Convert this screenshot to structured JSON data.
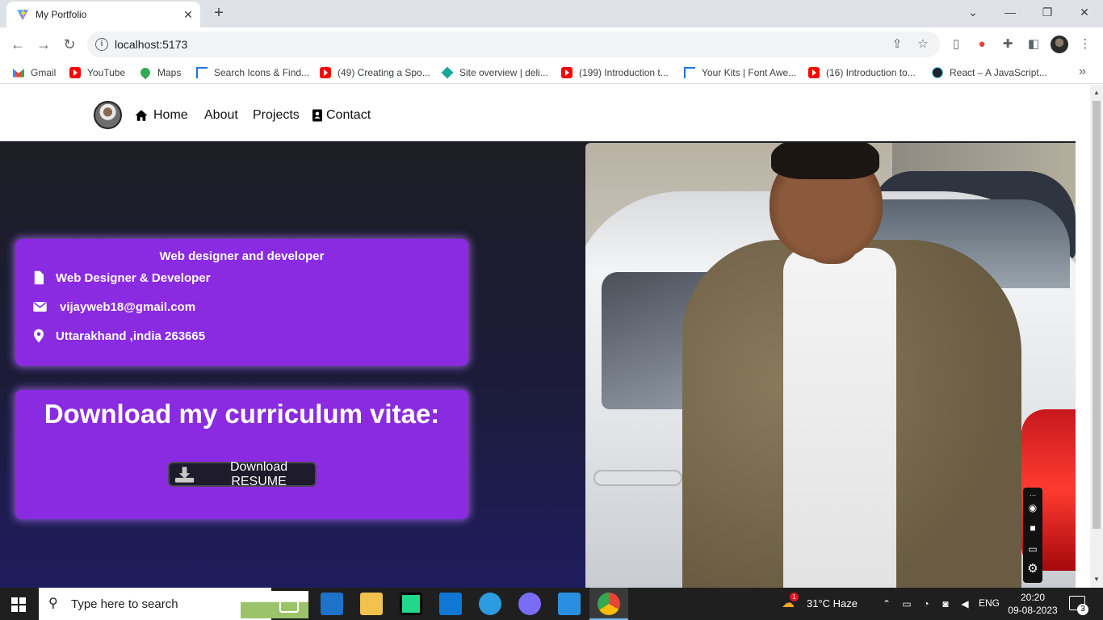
{
  "browser": {
    "tab": {
      "title": "My Portfolio"
    },
    "url": "localhost:5173",
    "bookmarks": [
      {
        "label": "Gmail",
        "icon": "gmail-icon"
      },
      {
        "label": "YouTube",
        "icon": "youtube-icon"
      },
      {
        "label": "Maps",
        "icon": "maps-icon"
      },
      {
        "label": "Search Icons & Find...",
        "icon": "flag-icon"
      },
      {
        "label": "(49) Creating a Spo...",
        "icon": "youtube-icon"
      },
      {
        "label": "Site overview | deli...",
        "icon": "diamond-icon"
      },
      {
        "label": "(199) Introduction t...",
        "icon": "youtube-icon"
      },
      {
        "label": "Your Kits | Font Awe...",
        "icon": "flag-icon"
      },
      {
        "label": "(16) Introduction to...",
        "icon": "youtube-icon"
      },
      {
        "label": "React – A JavaScript...",
        "icon": "react-icon"
      }
    ]
  },
  "site": {
    "nav": {
      "home": "Home",
      "about": "About",
      "projects": "Projects",
      "contact": "Contact"
    },
    "info_card": {
      "title": "Web designer and developer",
      "role": "Web Designer & Developer",
      "email": "vijayweb18@gmail.com",
      "location": "Uttarakhand ,india 263665"
    },
    "cv_card": {
      "title": "Download my curriculum vitae:",
      "button": "Download RESUME"
    }
  },
  "taskbar": {
    "search_placeholder": "Type here to search",
    "weather": "31°C  Haze",
    "weather_badge": "1",
    "language": "ENG",
    "time": "20:20",
    "date": "09-08-2023",
    "notifications": "3"
  },
  "colors": {
    "accent_purple": "#8a2be2",
    "hero_dark": "#1d1d25",
    "button_dark": "#1d1b2c"
  }
}
